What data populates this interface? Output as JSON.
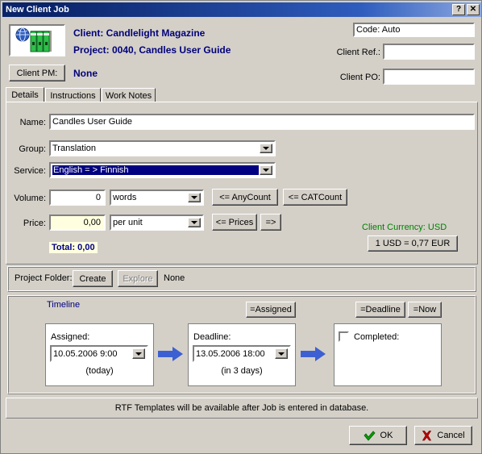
{
  "window": {
    "title": "New Client Job",
    "help_button": "?",
    "close_button": "✕"
  },
  "header": {
    "app_icon": "globe-binders-icon",
    "client_line": "Client: Candlelight Magazine",
    "project_line": "Project: 0040, Candles User Guide",
    "client_pm_button": "Client PM:",
    "client_pm_value": "None",
    "code_field_value": "Code: Auto",
    "client_ref_label": "Client Ref.:",
    "client_ref_value": "",
    "client_po_label": "Client PO:",
    "client_po_value": ""
  },
  "tabs": [
    {
      "label": "Details",
      "selected": true
    },
    {
      "label": "Instructions",
      "selected": false
    },
    {
      "label": "Work Notes",
      "selected": false
    }
  ],
  "details": {
    "name_label": "Name:",
    "name_value": "Candles User Guide",
    "group_label": "Group:",
    "group_value": "Translation",
    "service_label": "Service:",
    "service_value": "English = > Finnish",
    "volume_label": "Volume:",
    "volume_value": "0",
    "volume_unit": "words",
    "any_count_button": "<= AnyCount",
    "cat_count_button": "<= CATCount",
    "price_label": "Price:",
    "price_value": "0,00",
    "price_unit": "per unit",
    "prices_button": "<= Prices",
    "price_arrow_button": "=>",
    "total_label": "Total: 0,00",
    "client_currency": "Client Currency: USD",
    "exchange_rate_button": "1 USD = 0,77 EUR"
  },
  "project_folder": {
    "label": "Project Folder:",
    "create_button": "Create",
    "explore_button": "Explore",
    "status": "None"
  },
  "timeline": {
    "title": "Timeline",
    "assigned_button": "=Assigned",
    "deadline_button": "=Deadline",
    "now_button": "=Now",
    "assigned_label": "Assigned:",
    "assigned_value": "10.05.2006 9:00",
    "assigned_hint": "(today)",
    "deadline_label": "Deadline:",
    "deadline_value": "13.05.2006 18:00",
    "deadline_hint": "(in 3 days)",
    "completed_label": "Completed:",
    "completed_checked": false
  },
  "footer": {
    "status_text": "RTF Templates will be available after Job is entered in database.",
    "ok_button": "OK",
    "cancel_button": "Cancel"
  },
  "colors": {
    "face": "#d4d0c8",
    "title_start": "#0a246a",
    "accent_blue": "#000080",
    "green_text": "#008000",
    "field_cream": "#ffffe0",
    "arrow_blue": "#3c5fd2",
    "selection": "#000080"
  }
}
